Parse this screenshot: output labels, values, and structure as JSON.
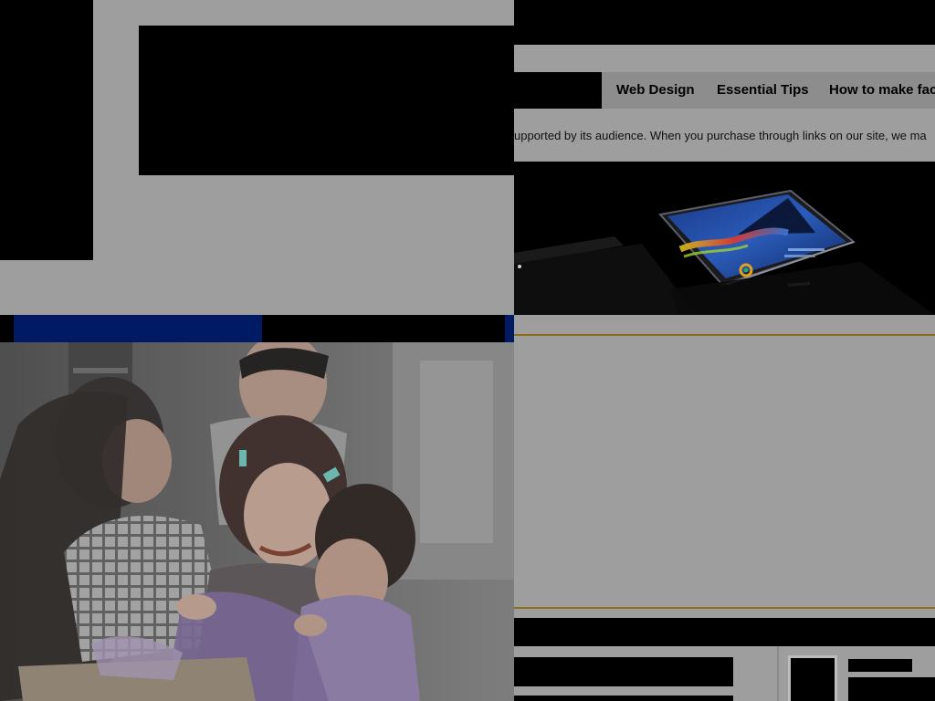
{
  "nav": {
    "links": [
      "Web Design",
      "Essential Tips",
      "How to make fac"
    ]
  },
  "affiliate_note": "upported by its audience. When you purchase through links on our site, we ma",
  "hero": {
    "description": "",
    "icon": "smartphone-image"
  },
  "ad": {
    "icon": "family-photo"
  },
  "colors": {
    "page_bg": "#9e9e9e",
    "gold_accent": "#8a6d1c",
    "ad_blue": "#001a66",
    "nav_bg": "#8d8d8d"
  }
}
